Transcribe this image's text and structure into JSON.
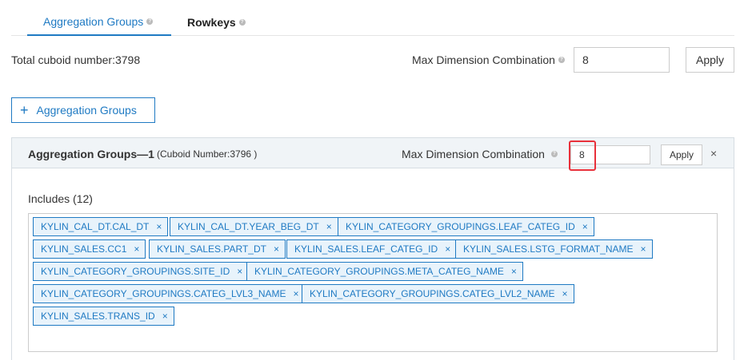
{
  "tabs": [
    {
      "label": "Aggregation Groups",
      "active": true
    },
    {
      "label": "Rowkeys",
      "active": false
    }
  ],
  "total_label": "Total cuboid number:3798",
  "global": {
    "mdc_label": "Max Dimension Combination",
    "mdc_value": "8",
    "apply_label": "Apply"
  },
  "add_button_label": "Aggregation Groups",
  "group": {
    "title": "Aggregation Groups—1",
    "subtitle": "(Cuboid Number:3796 )",
    "mdc_label": "Max Dimension Combination",
    "mdc_value": "8",
    "apply_label": "Apply",
    "close_symbol": "×",
    "includes_label": "Includes (12)",
    "tags": [
      "KYLIN_CAL_DT.CAL_DT",
      "KYLIN_CAL_DT.YEAR_BEG_DT",
      "KYLIN_CATEGORY_GROUPINGS.LEAF_CATEG_ID",
      "KYLIN_SALES.CC1",
      "KYLIN_SALES.PART_DT",
      "KYLIN_SALES.LEAF_CATEG_ID",
      "KYLIN_SALES.LSTG_FORMAT_NAME",
      "KYLIN_CATEGORY_GROUPINGS.SITE_ID",
      "KYLIN_CATEGORY_GROUPINGS.META_CATEG_NAME",
      "KYLIN_CATEGORY_GROUPINGS.CATEG_LVL3_NAME",
      "KYLIN_CATEGORY_GROUPINGS.CATEG_LVL2_NAME",
      "KYLIN_SALES.TRANS_ID"
    ]
  },
  "colors": {
    "accent": "#1f7ac3",
    "highlight": "#e8303a",
    "tag_bg": "#e8f3fb",
    "panel_header_bg": "#f0f4f7"
  },
  "icons": [
    "help-icon",
    "plus-icon",
    "close-icon",
    "remove-tag-icon"
  ]
}
